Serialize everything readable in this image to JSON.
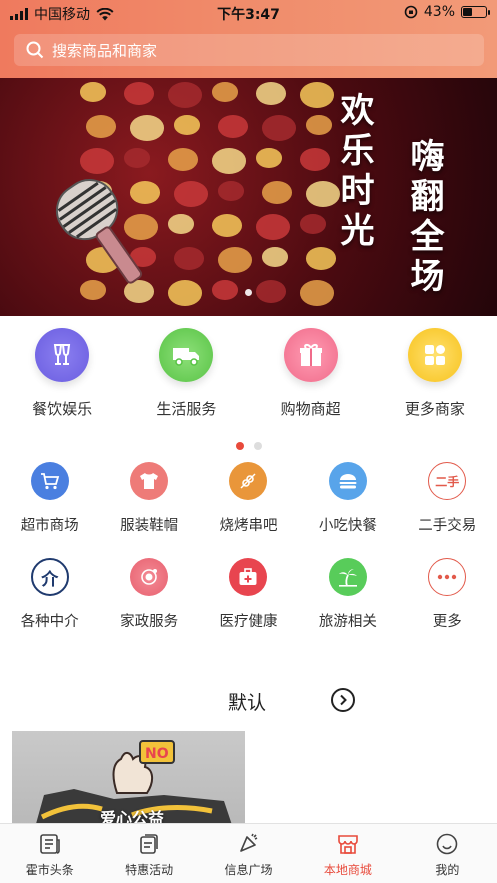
{
  "status_bar": {
    "carrier": "中国移动",
    "time": "下午3:47",
    "battery": "43%",
    "battery_level": 0.43
  },
  "search": {
    "placeholder": "搜索商品和商家"
  },
  "banner": {
    "line1": "欢乐时光",
    "line2": "嗨翻全场"
  },
  "main_categories": [
    {
      "label": "餐饮娱乐",
      "icon": "wine-glass-icon"
    },
    {
      "label": "生活服务",
      "icon": "truck-icon"
    },
    {
      "label": "购物商超",
      "icon": "gift-icon"
    },
    {
      "label": "更多商家",
      "icon": "grid-icon"
    }
  ],
  "sub_categories": [
    {
      "label": "超市商场",
      "icon": "cart-icon"
    },
    {
      "label": "服装鞋帽",
      "icon": "tshirt-icon"
    },
    {
      "label": "烧烤串吧",
      "icon": "skewer-icon"
    },
    {
      "label": "小吃快餐",
      "icon": "burger-icon"
    },
    {
      "label": "二手交易",
      "icon": "secondhand-icon",
      "text": "二手"
    },
    {
      "label": "各种中介",
      "icon": "agency-icon",
      "text": "介"
    },
    {
      "label": "家政服务",
      "icon": "housekeeping-icon"
    },
    {
      "label": "医疗健康",
      "icon": "medical-kit-icon"
    },
    {
      "label": "旅游相关",
      "icon": "palm-tree-icon"
    },
    {
      "label": "更多",
      "icon": "more-dots-icon"
    }
  ],
  "sort": {
    "label": "默认"
  },
  "card": {
    "title": "爱心公益"
  },
  "tabs": [
    {
      "label": "霍市头条",
      "icon": "news-icon"
    },
    {
      "label": "特惠活动",
      "icon": "coupon-icon"
    },
    {
      "label": "信息广场",
      "icon": "megaphone-icon"
    },
    {
      "label": "本地商城",
      "icon": "store-icon",
      "active": true
    },
    {
      "label": "我的",
      "icon": "smile-face-icon"
    }
  ],
  "colors": {
    "accent": "#e84a3b",
    "header": "#ef7a5e"
  }
}
